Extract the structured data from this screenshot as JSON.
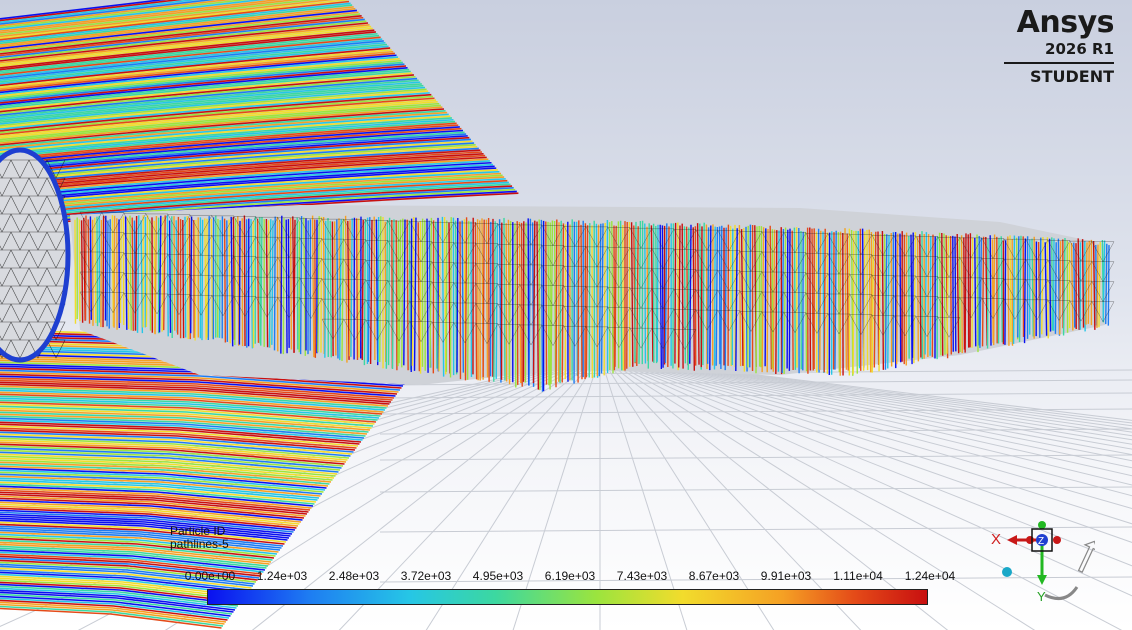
{
  "branding": {
    "name": "Ansys",
    "version": "2026 R1",
    "edition": "STUDENT"
  },
  "legend": {
    "variable": "Particle ID",
    "object": "pathlines-5",
    "ticks": [
      "0.00e+00",
      "1.24e+03",
      "2.48e+03",
      "3.72e+03",
      "4.95e+03",
      "6.19e+03",
      "7.43e+03",
      "8.67e+03",
      "9.91e+03",
      "1.11e+04",
      "1.24e+04"
    ],
    "colormap": [
      "#0a10f0",
      "#1e7cf2",
      "#26c6e6",
      "#3cd8a0",
      "#9be43e",
      "#f2dc2c",
      "#f5a024",
      "#e44a18",
      "#c81010"
    ]
  },
  "triad": {
    "x_label": "X",
    "y_label": "Y",
    "z_label": "Z"
  }
}
